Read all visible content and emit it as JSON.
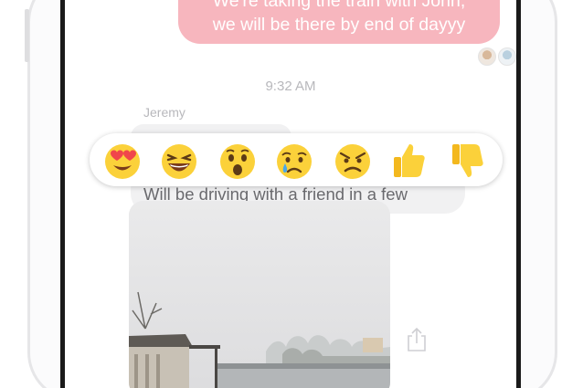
{
  "outgoing_message": {
    "line1": "We're taking the train with John,",
    "line2": "we will be there by end of dayyy"
  },
  "timestamp": "9:32 AM",
  "incoming": {
    "sender": "Jeremy",
    "text": "Will be driving with a friend in a few"
  },
  "reactions": [
    "heart-eyes",
    "laughing",
    "wow",
    "sad",
    "angry",
    "thumbs-up",
    "thumbs-down"
  ],
  "colors": {
    "outgoing_bubble": "#f7b6be",
    "incoming_bubble": "#f1f1f2",
    "emoji_yellow": "#fbd13a"
  }
}
